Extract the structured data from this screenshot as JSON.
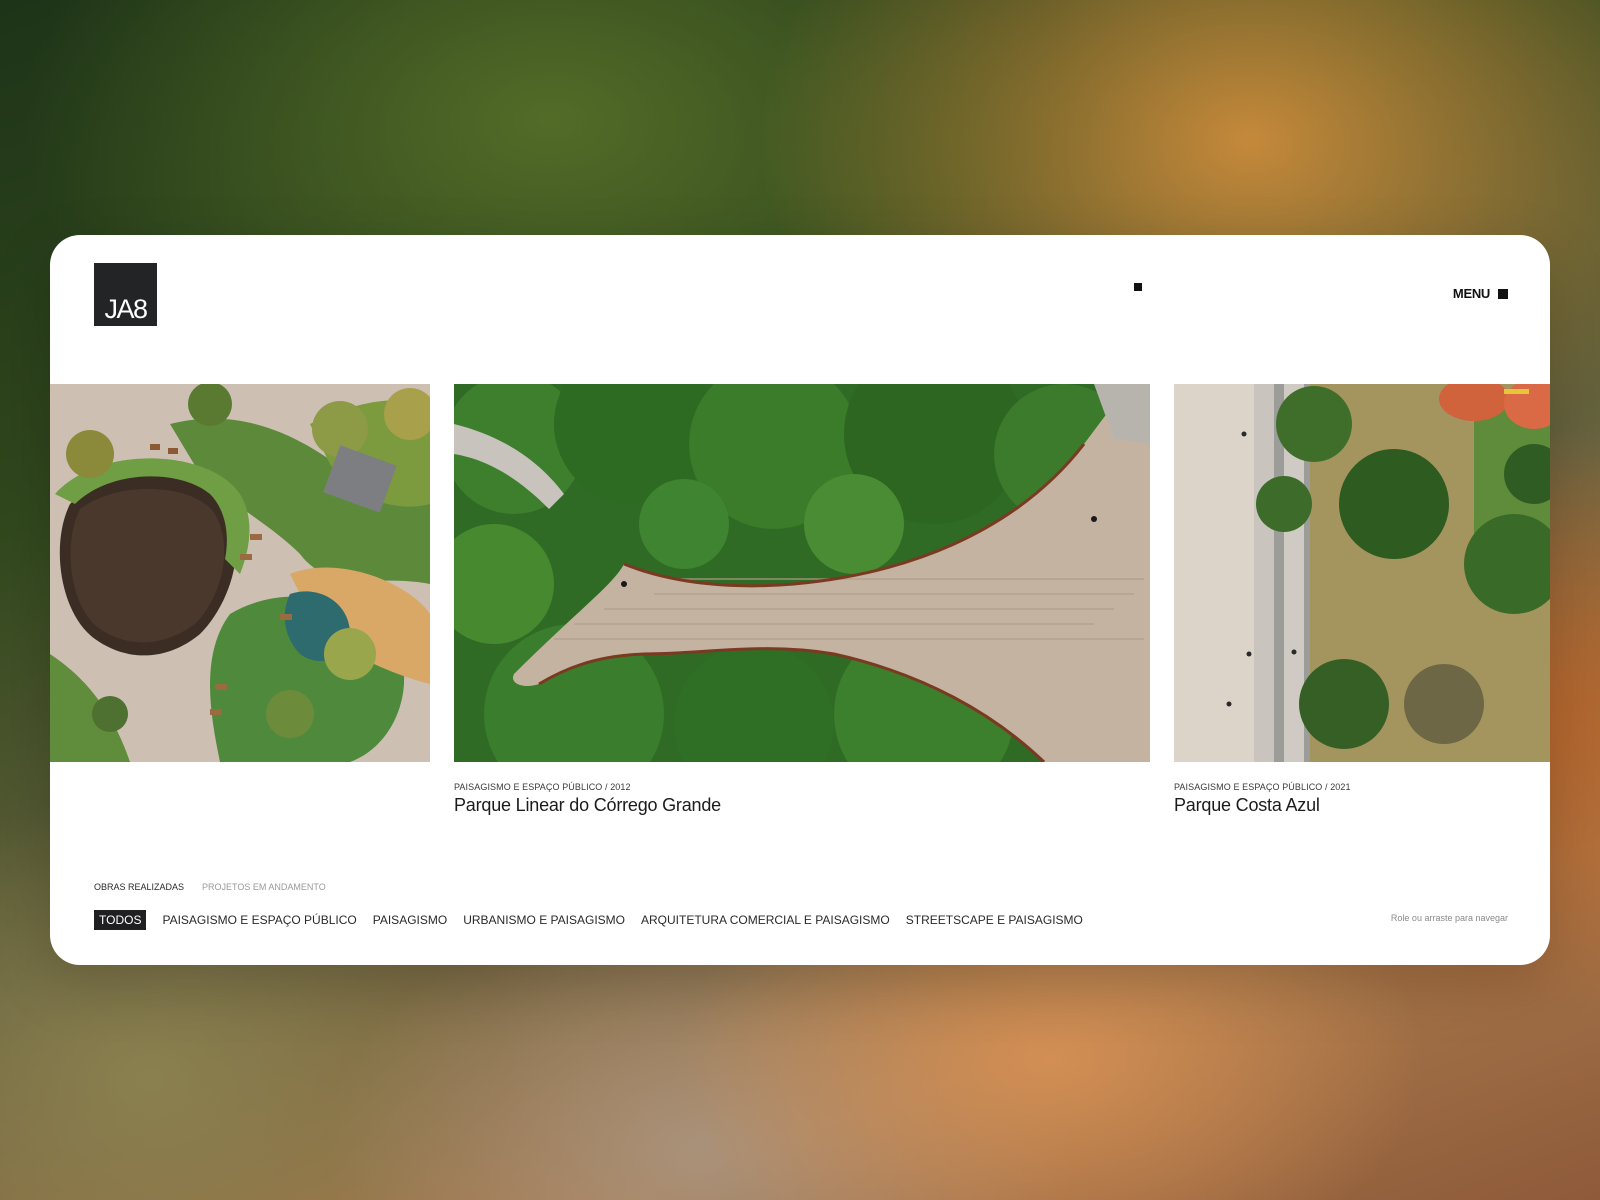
{
  "brand": {
    "logo_text": "JA8"
  },
  "header": {
    "menu_label": "MENU"
  },
  "projects": [
    {
      "category": "",
      "title": "",
      "image": "aerial-plaza-garden-photo"
    },
    {
      "category": "PAISAGISMO E ESPAÇO PÚBLICO / 2012",
      "title": "Parque Linear do Córrego Grande",
      "image": "aerial-boardwalk-forest-photo"
    },
    {
      "category": "PAISAGISMO E ESPAÇO PÚBLICO / 2021",
      "title": "Parque Costa Azul",
      "image": "aerial-beach-park-photo"
    }
  ],
  "status_tabs": [
    {
      "label": "OBRAS REALIZADAS",
      "active": true
    },
    {
      "label": "PROJETOS EM ANDAMENTO",
      "active": false
    }
  ],
  "filters": [
    {
      "label": "TODOS",
      "active": true
    },
    {
      "label": "PAISAGISMO E ESPAÇO PÚBLICO",
      "active": false
    },
    {
      "label": "PAISAGISMO",
      "active": false
    },
    {
      "label": "URBANISMO E PAISAGISMO",
      "active": false
    },
    {
      "label": "ARQUITETURA COMERCIAL E PAISAGISMO",
      "active": false
    },
    {
      "label": "STREETSCAPE E PAISAGISMO",
      "active": false
    }
  ],
  "hint": "Role ou arraste para navegar",
  "colors": {
    "logo_bg": "#232426",
    "active_filter_bg": "#1f1f22",
    "card_bg": "#ffffff"
  }
}
